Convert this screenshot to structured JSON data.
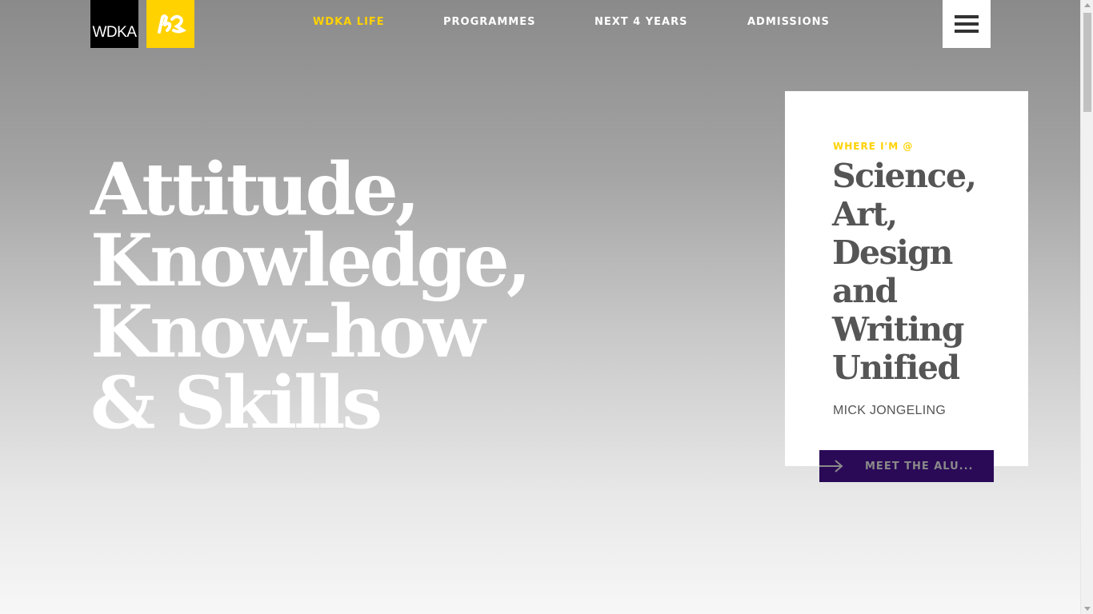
{
  "header": {
    "logo_text": "WDKA",
    "nav": [
      {
        "label": "WDKA LIFE",
        "active": true
      },
      {
        "label": "PROGRAMMES",
        "active": false
      },
      {
        "label": "NEXT 4 YEARS",
        "active": false
      },
      {
        "label": "ADMISSIONS",
        "active": false
      }
    ],
    "menu_icon": "hamburger-icon"
  },
  "hero": {
    "lines": [
      "Attitude,",
      "Knowledge,",
      "Know-how",
      "& Skills"
    ]
  },
  "card": {
    "kicker": "WHERE I'M @",
    "title_lines": [
      "Science,",
      "Art,",
      "Design",
      "and",
      "Writing",
      "Unified"
    ],
    "author": "MICK JONGELING",
    "cta_label": "MEET THE ALU..."
  },
  "colors": {
    "accent_yellow": "#ffd200",
    "cta_purple": "#2a0a57",
    "text_gray": "#555555"
  }
}
